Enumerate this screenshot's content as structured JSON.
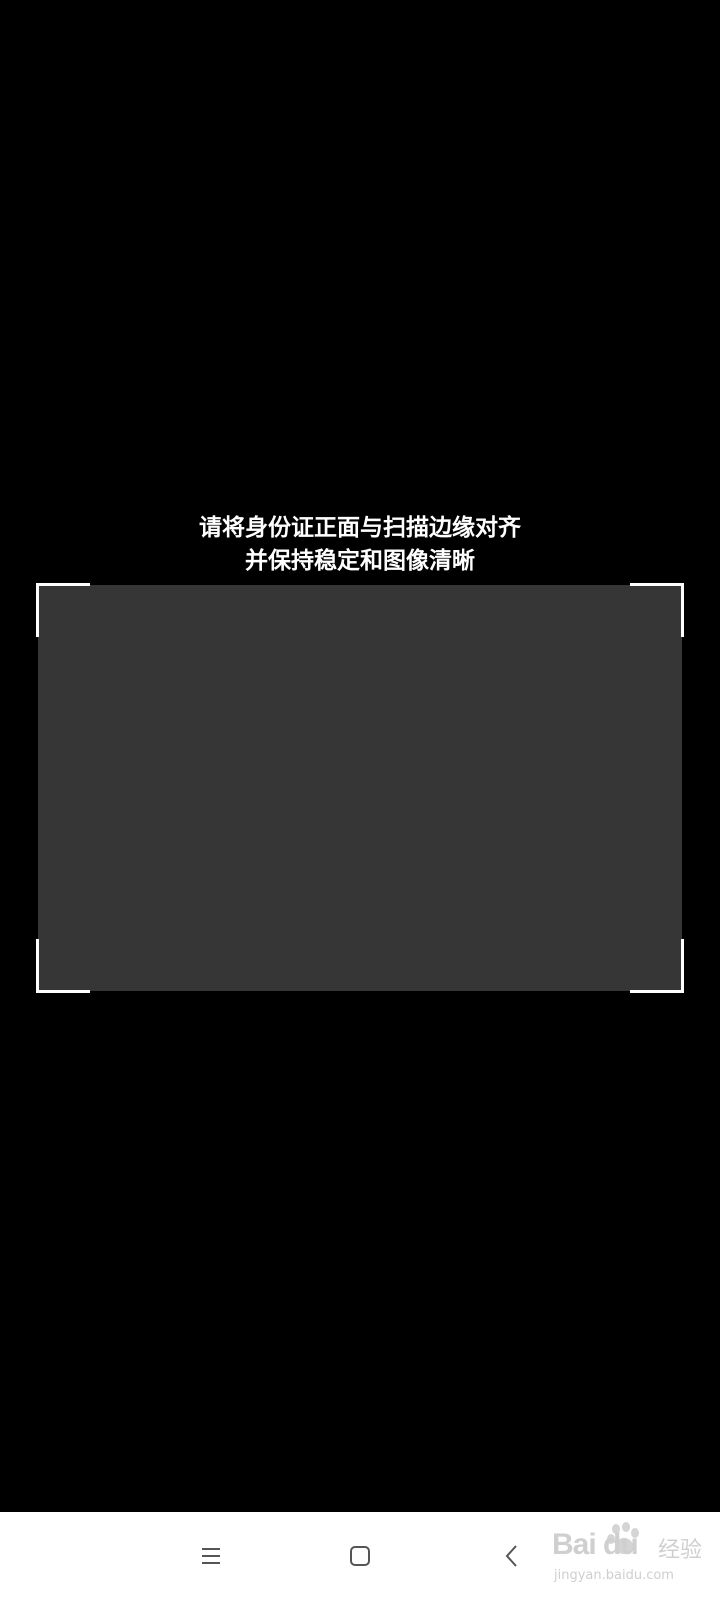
{
  "instruction": {
    "line1": "请将身份证正面与扫描边缘对齐",
    "line2": "并保持稳定和图像清晰"
  },
  "nav_bar": {
    "menu_icon": "menu-icon",
    "home_icon": "home-icon",
    "back_icon": "back-icon"
  },
  "watermark": {
    "brand": "Bai du",
    "sub": "经验",
    "url": "jingyan.baidu.com"
  },
  "colors": {
    "background": "#000000",
    "scan_area": "#363636",
    "frame_corners": "#ffffff",
    "nav_bar": "#ffffff",
    "nav_icons": "#555555"
  }
}
